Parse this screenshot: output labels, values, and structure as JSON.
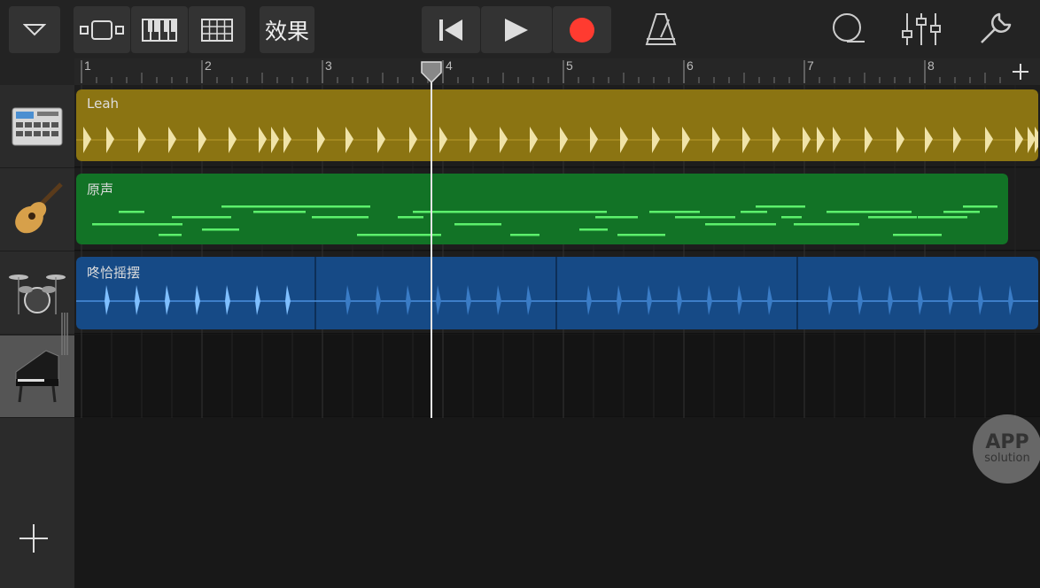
{
  "toolbar": {
    "effects_label": "效果",
    "icons": [
      "track-menu-icon",
      "tracks-view-icon",
      "keyboard-icon",
      "grid-icon",
      "go-to-start-icon",
      "play-icon",
      "record-icon",
      "metronome-icon",
      "loop-browser-icon",
      "mixer-icon",
      "settings-wrench-icon"
    ],
    "record_color": "#ff3b30"
  },
  "ruler": {
    "bars": [
      "1",
      "2",
      "3",
      "4",
      "5",
      "6",
      "7",
      "8"
    ],
    "add_label": "+"
  },
  "tracks": [
    {
      "instrument": "drum-machine",
      "region": {
        "name": "Leah",
        "color": "#8b7412",
        "text_color": "#f0e3a8"
      }
    },
    {
      "instrument": "acoustic-guitar",
      "region": {
        "name": "原声",
        "color": "#127326",
        "text_color": "#5cf06c"
      }
    },
    {
      "instrument": "drum-kit",
      "region": {
        "name": "咚恰摇摆",
        "color": "#164a86",
        "text_color": "#7fbfff"
      }
    },
    {
      "instrument": "grand-piano",
      "selected": true,
      "region": null
    }
  ],
  "add_track_label": "+",
  "watermark": {
    "line1": "APP",
    "line2": "solution"
  }
}
